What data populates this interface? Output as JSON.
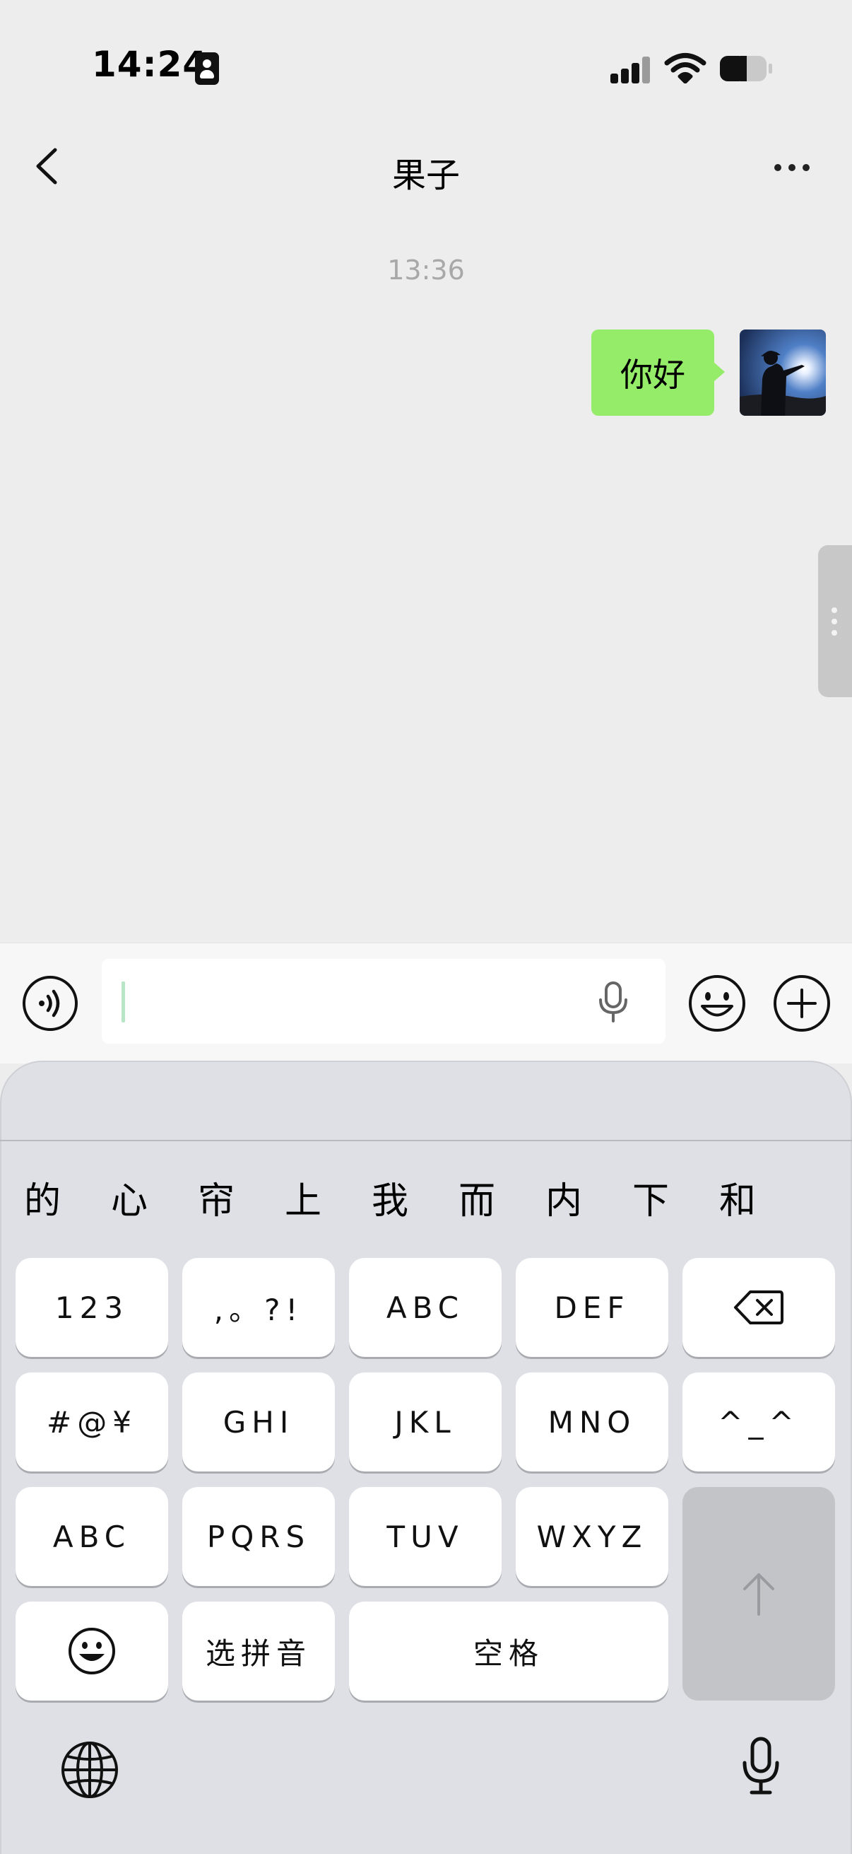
{
  "status_bar": {
    "time": "14:24"
  },
  "nav": {
    "title": "果子"
  },
  "chat": {
    "timestamp": "13:36",
    "messages": [
      {
        "from": "me",
        "text": "你好"
      }
    ]
  },
  "keyboard": {
    "candidates": [
      "的",
      "心",
      "帘",
      "上",
      "我",
      "而",
      "内",
      "下",
      "和"
    ],
    "row1": [
      "123",
      ",。?!",
      "ABC",
      "DEF"
    ],
    "row2": [
      "#@¥",
      "GHI",
      "JKL",
      "MNO",
      "^_^"
    ],
    "row3": [
      "ABC",
      "PQRS",
      "TUV",
      "WXYZ"
    ],
    "row4": {
      "select_pinyin": "选拼音",
      "space": "空格"
    }
  },
  "colors": {
    "bubble": "#95ec69",
    "background": "#ededed",
    "keyboard": "#dfe0e5"
  },
  "icons": [
    "id-card-icon",
    "signal-icon",
    "wifi-icon",
    "battery-icon",
    "back-icon",
    "more-icon",
    "voice-icon",
    "microphone-icon",
    "emoji-icon",
    "plus-icon",
    "backspace-icon",
    "return-icon",
    "globe-icon"
  ]
}
